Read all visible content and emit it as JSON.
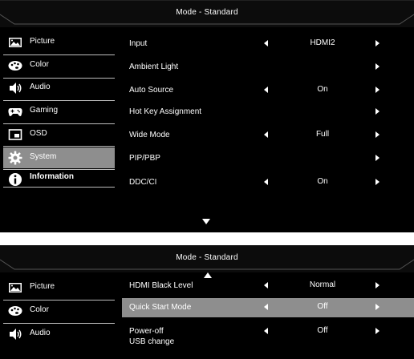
{
  "top": {
    "title": "Mode - Standard",
    "sidebar": [
      {
        "label": "Picture",
        "icon": "picture-icon"
      },
      {
        "label": "Color",
        "icon": "palette-icon"
      },
      {
        "label": "Audio",
        "icon": "speaker-icon"
      },
      {
        "label": "Gaming",
        "icon": "gamepad-icon"
      },
      {
        "label": "OSD",
        "icon": "osd-icon"
      },
      {
        "label": "System",
        "icon": "gear-icon",
        "active": true
      },
      {
        "label": "Information",
        "icon": "info-icon"
      }
    ],
    "rows": [
      {
        "label": "Input",
        "value": "HDMI2",
        "left_arrow": true
      },
      {
        "label": "Ambient Light",
        "value": "",
        "left_arrow": false
      },
      {
        "label": "Auto Source",
        "value": "On",
        "left_arrow": true
      },
      {
        "label": "Hot Key Assignment",
        "value": "",
        "left_arrow": false
      },
      {
        "label": "Wide Mode",
        "value": "Full",
        "left_arrow": true
      },
      {
        "label": "PIP/PBP",
        "value": "",
        "left_arrow": false
      },
      {
        "label": "DDC/CI",
        "value": "On",
        "left_arrow": true
      }
    ]
  },
  "bottom": {
    "title": "Mode - Standard",
    "sidebar": [
      {
        "label": "Picture",
        "icon": "picture-icon"
      },
      {
        "label": "Color",
        "icon": "palette-icon"
      },
      {
        "label": "Audio",
        "icon": "speaker-icon"
      }
    ],
    "rows": [
      {
        "label": "HDMI Black Level",
        "value": "Normal",
        "left_arrow": true
      },
      {
        "label": "Quick Start Mode",
        "value": "Off",
        "left_arrow": true,
        "highlighted": true
      },
      {
        "label": "Power-off",
        "label2": "USB change",
        "value": "Off",
        "left_arrow": true
      }
    ]
  },
  "colors": {
    "background": "#000000",
    "highlight": "#8e8e8e",
    "text": "#ffffff"
  }
}
